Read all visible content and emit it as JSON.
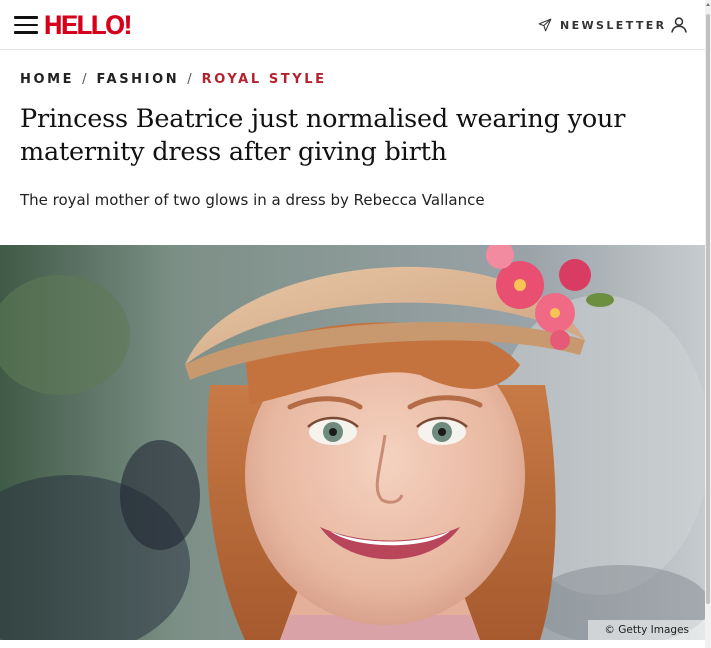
{
  "header": {
    "menu_icon": "hamburger-menu-icon",
    "logo_text": "HELLO!",
    "newsletter_icon": "paper-plane-icon",
    "newsletter_label": "NEWSLETTER",
    "account_icon": "user-icon",
    "brand_color": "#d6001c"
  },
  "breadcrumb": {
    "items": [
      {
        "label": "HOME"
      },
      {
        "label": "FASHION"
      },
      {
        "label": "ROYAL STYLE"
      }
    ],
    "separator": "/",
    "current_color": "#b3232f"
  },
  "article": {
    "headline": "Princess Beatrice just normalised wearing your maternity dress after giving birth",
    "standfirst": "The royal mother of two glows in a dress by Rebecca Vallance",
    "image": {
      "credit": "© Getty Images"
    }
  }
}
